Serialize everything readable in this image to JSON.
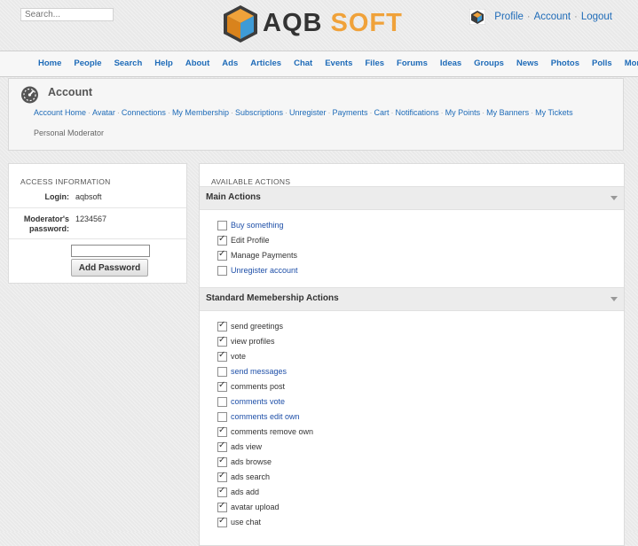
{
  "header": {
    "search_placeholder": "Search...",
    "logo_left": "AQB",
    "logo_right": "SOFT",
    "user_links": [
      "Profile",
      "Account",
      "Logout"
    ]
  },
  "nav": [
    "Home",
    "People",
    "Search",
    "Help",
    "About",
    "Ads",
    "Articles",
    "Chat",
    "Events",
    "Files",
    "Forums",
    "Ideas",
    "Groups",
    "News",
    "Photos",
    "Polls",
    "More"
  ],
  "account": {
    "title": "Account",
    "submenu": [
      "Account Home",
      "Avatar",
      "Connections",
      "My Membership",
      "Subscriptions",
      "Unregister",
      "Payments",
      "Cart",
      "Notifications",
      "My Points",
      "My Banners",
      "My Tickets"
    ],
    "current": "Personal Moderator"
  },
  "access": {
    "title": "ACCESS INFORMATION",
    "login_label": "Login:",
    "login_value": "aqbsoft",
    "password_label_1": "Moderator's",
    "password_label_2": "password:",
    "password_value": "1234567",
    "new_password_value": "",
    "add_button": "Add Password"
  },
  "actions": {
    "title": "AVAILABLE ACTIONS",
    "sections": [
      {
        "title": "Main Actions",
        "items": [
          {
            "label": "Buy something",
            "checked": false
          },
          {
            "label": "Edit Profile",
            "checked": true
          },
          {
            "label": "Manage Payments",
            "checked": true
          },
          {
            "label": "Unregister account",
            "checked": false
          }
        ]
      },
      {
        "title": "Standard Memebership Actions",
        "items": [
          {
            "label": "send greetings",
            "checked": true
          },
          {
            "label": "view profiles",
            "checked": true
          },
          {
            "label": "vote",
            "checked": true
          },
          {
            "label": "send messages",
            "checked": false
          },
          {
            "label": "comments post",
            "checked": true
          },
          {
            "label": "comments vote",
            "checked": false
          },
          {
            "label": "comments edit own",
            "checked": false
          },
          {
            "label": "comments remove own",
            "checked": true
          },
          {
            "label": "ads view",
            "checked": true
          },
          {
            "label": "ads browse",
            "checked": true
          },
          {
            "label": "ads search",
            "checked": true
          },
          {
            "label": "ads add",
            "checked": true
          },
          {
            "label": "avatar upload",
            "checked": true
          },
          {
            "label": "use chat",
            "checked": true
          }
        ]
      }
    ]
  },
  "colors": {
    "link": "#1e6bb8",
    "logo_orange": "#f0a23a",
    "unchecked_link": "#1e4fa8"
  }
}
